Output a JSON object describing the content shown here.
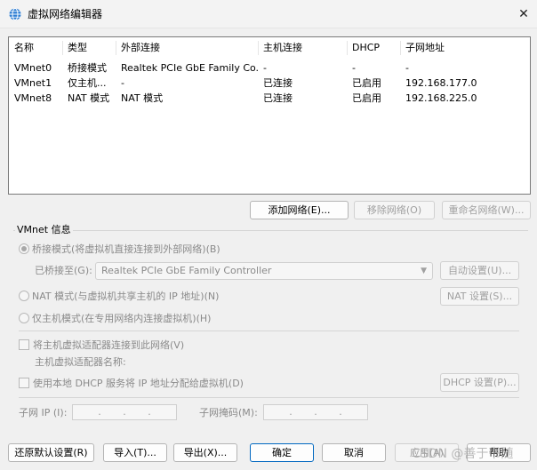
{
  "window": {
    "title": "虚拟网络编辑器",
    "close_label": "✕"
  },
  "table": {
    "headers": [
      "名称",
      "类型",
      "外部连接",
      "主机连接",
      "DHCP",
      "子网地址"
    ],
    "rows": [
      [
        "VMnet0",
        "桥接模式",
        "Realtek PCIe GbE Family Co...",
        "-",
        "-",
        "-"
      ],
      [
        "VMnet1",
        "仅主机...",
        "-",
        "已连接",
        "已启用",
        "192.168.177.0"
      ],
      [
        "VMnet8",
        "NAT 模式",
        "NAT 模式",
        "已连接",
        "已启用",
        "192.168.225.0"
      ]
    ]
  },
  "list_buttons": {
    "add": "添加网络(E)...",
    "remove": "移除网络(O)",
    "rename": "重命名网络(W)..."
  },
  "vmnet_info": {
    "group_label": "VMnet 信息",
    "bridged_label": "桥接模式(将虚拟机直接连接到外部网络)(B)",
    "bridged_to_label": "已桥接至(G):",
    "bridged_to_value": "Realtek PCIe GbE Family Controller",
    "auto_settings": "自动设置(U)...",
    "nat_label": "NAT 模式(与虚拟机共享主机的 IP 地址)(N)",
    "nat_settings": "NAT 设置(S)...",
    "hostonly_label": "仅主机模式(在专用网络内连接虚拟机)(H)",
    "connect_adapter_label": "将主机虚拟适配器连接到此网络(V)",
    "adapter_name_label": "主机虚拟适配器名称:",
    "dhcp_label": "使用本地 DHCP 服务将 IP 地址分配给虚拟机(D)",
    "dhcp_settings": "DHCP 设置(P)...",
    "subnet_ip_label": "子网 IP (I):",
    "subnet_mask_label": "子网掩码(M):",
    "ip_dots": [
      ".",
      ".",
      "."
    ]
  },
  "footer": {
    "restore": "还原默认设置(R)",
    "import": "导入(T)...",
    "export": "导出(X)...",
    "ok": "确定",
    "cancel": "取消",
    "apply": "应用(A)",
    "help": "帮助"
  },
  "watermark": "CSDN @善于书随",
  "colors": {
    "accent": "#0067c0",
    "icon_blue": "#2b7cd3"
  }
}
